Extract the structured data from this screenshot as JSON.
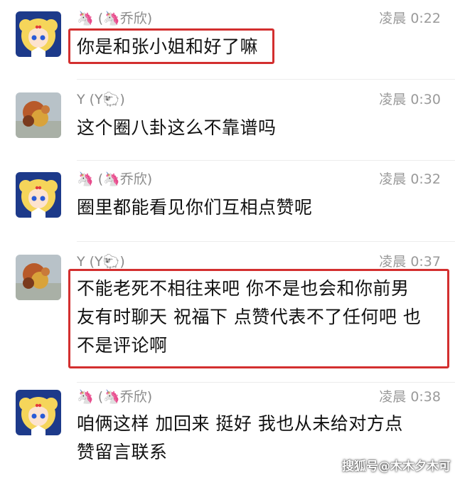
{
  "messages": [
    {
      "sender": "🦄 (🦄乔欣)",
      "time": "凌晨 0:22",
      "avatar": "sailor-moon-avatar",
      "lines": [
        "你是和张小姐和好了嘛"
      ],
      "highlighted": true
    },
    {
      "sender": "Y (Y🐑)",
      "time": "凌晨 0:30",
      "avatar": "blurred-photo-avatar",
      "lines": [
        "这个圈八卦这么不靠谱吗"
      ],
      "highlighted": false
    },
    {
      "sender": "🦄 (🦄乔欣)",
      "time": "凌晨 0:32",
      "avatar": "sailor-moon-avatar",
      "lines": [
        "圈里都能看见你们互相点赞呢"
      ],
      "highlighted": false
    },
    {
      "sender": "Y (Y🐑)",
      "time": "凌晨 0:37",
      "avatar": "blurred-photo-avatar",
      "lines": [
        "不能老死不相往来吧 你不是也会和你前男",
        "友有时聊天 祝福下 点赞代表不了任何吧 也",
        "不是评论啊"
      ],
      "highlighted": true
    },
    {
      "sender": "🦄 (🦄乔欣)",
      "time": "凌晨 0:38",
      "avatar": "sailor-moon-avatar",
      "lines": [
        "咱俩这样 加回来 挺好  我也从未给对方点",
        "赞留言联系"
      ],
      "highlighted": false
    }
  ],
  "watermark": "搜狐号@木木夕木可",
  "colors": {
    "highlight_border": "#d32f2f",
    "meta_text": "#8a8a8a",
    "message_text": "#111111"
  }
}
